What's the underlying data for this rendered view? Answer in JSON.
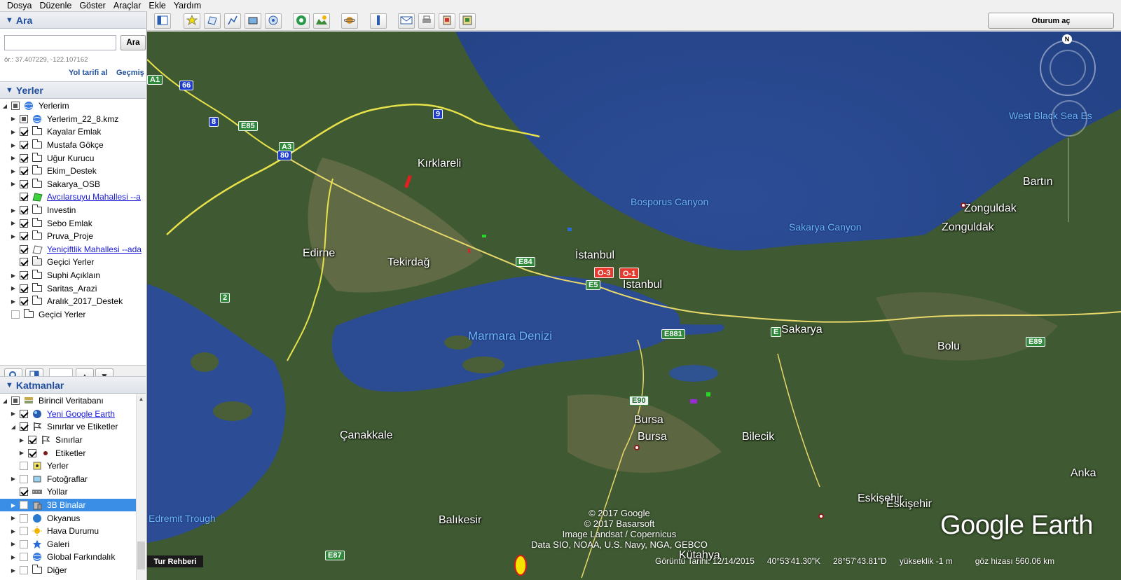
{
  "menu": [
    "Dosya",
    "Düzenle",
    "Göster",
    "Araçlar",
    "Ekle",
    "Yardım"
  ],
  "search": {
    "header": "Ara",
    "input_value": "",
    "button": "Ara",
    "hint": "ör.: 37.407229, -122.107162",
    "directions": "Yol tarifi al",
    "history": "Geçmiş"
  },
  "places": {
    "header": "Yerler",
    "items": [
      {
        "label": "Yerlerim",
        "icon": "globe-icon",
        "check": "partial",
        "expand": "down",
        "indent": 0
      },
      {
        "label": "Yerlerim_22_8.kmz",
        "icon": "globe-icon",
        "check": "partial",
        "expand": "right",
        "indent": 1
      },
      {
        "label": "Kayalar Emlak",
        "icon": "folder-icon",
        "check": "on",
        "expand": "right",
        "indent": 1
      },
      {
        "label": "Mustafa Gökçe",
        "icon": "folder-icon",
        "check": "on",
        "expand": "right",
        "indent": 1
      },
      {
        "label": "Uğur Kurucu",
        "icon": "folder-icon",
        "check": "on",
        "expand": "right",
        "indent": 1
      },
      {
        "label": "Ekim_Destek",
        "icon": "folder-icon",
        "check": "on",
        "expand": "right",
        "indent": 1
      },
      {
        "label": "Sakarya_OSB",
        "icon": "folder-icon",
        "check": "on",
        "expand": "right",
        "indent": 1
      },
      {
        "label": "Avcılarsuyu Mahallesi --a",
        "icon": "polygon-green-icon",
        "check": "on",
        "expand": "none",
        "indent": 1,
        "link": true
      },
      {
        "label": "Investin",
        "icon": "folder-icon",
        "check": "on",
        "expand": "right",
        "indent": 1
      },
      {
        "label": "Sebo Emlak",
        "icon": "folder-icon",
        "check": "on",
        "expand": "right",
        "indent": 1
      },
      {
        "label": "Pruva_Proje",
        "icon": "folder-icon",
        "check": "on",
        "expand": "right",
        "indent": 1
      },
      {
        "label": "Yeniçiftlik Mahallesi --ada",
        "icon": "polygon-white-icon",
        "check": "on",
        "expand": "none",
        "indent": 1,
        "link": true
      },
      {
        "label": "Geçici Yerler",
        "icon": "temp-folder-icon",
        "check": "on",
        "expand": "none",
        "indent": 1
      },
      {
        "label": "Suphi Açıklaın",
        "icon": "folder-icon",
        "check": "on",
        "expand": "right",
        "indent": 1
      },
      {
        "label": "Saritas_Arazi",
        "icon": "folder-icon",
        "check": "on",
        "expand": "right",
        "indent": 1
      },
      {
        "label": "Aralık_2017_Destek",
        "icon": "folder-icon",
        "check": "on",
        "expand": "right",
        "indent": 1
      },
      {
        "label": "Geçici Yerler",
        "icon": "folder-icon",
        "check": "empty",
        "expand": "none",
        "indent": 0
      }
    ]
  },
  "layers": {
    "header": "Katmanlar",
    "items": [
      {
        "label": "Birincil Veritabanı",
        "icon": "layers-db-icon",
        "check": "partial",
        "expand": "down",
        "indent": 0
      },
      {
        "label": "Yeni Google Earth",
        "icon": "globe-blue-icon",
        "check": "on",
        "expand": "right",
        "indent": 1,
        "link": true
      },
      {
        "label": "Sınırlar ve Etiketler",
        "icon": "flag-icon",
        "check": "on",
        "expand": "down",
        "indent": 1
      },
      {
        "label": "Sınırlar",
        "icon": "flag-icon",
        "check": "on",
        "expand": "right",
        "indent": 2
      },
      {
        "label": "Etiketler",
        "icon": "dot-icon",
        "check": "on",
        "expand": "right",
        "indent": 2
      },
      {
        "label": "Yerler",
        "icon": "places-square-icon",
        "check": "empty",
        "expand": "none",
        "indent": 1
      },
      {
        "label": "Fotoğraflar",
        "icon": "photo-icon",
        "check": "empty",
        "expand": "right",
        "indent": 1
      },
      {
        "label": "Yollar",
        "icon": "road-icon",
        "check": "on",
        "expand": "none",
        "indent": 1
      },
      {
        "label": "3B Binalar",
        "icon": "building-icon",
        "check": "empty",
        "expand": "right",
        "indent": 1,
        "selected": true
      },
      {
        "label": "Okyanus",
        "icon": "ocean-icon",
        "check": "empty",
        "expand": "right",
        "indent": 1
      },
      {
        "label": "Hava Durumu",
        "icon": "sun-icon",
        "check": "empty",
        "expand": "right",
        "indent": 1
      },
      {
        "label": "Galeri",
        "icon": "star-icon",
        "check": "empty",
        "expand": "right",
        "indent": 1
      },
      {
        "label": "Global Farkındalık",
        "icon": "globe-icon",
        "check": "empty",
        "expand": "right",
        "indent": 1
      },
      {
        "label": "Diğer",
        "icon": "folder-icon",
        "check": "empty",
        "expand": "right",
        "indent": 1
      }
    ]
  },
  "toolbar": {
    "signin": "Oturum aç",
    "buttons": [
      "sidebar-toggle-icon",
      "placemark-icon",
      "polygon-icon",
      "path-icon",
      "image-overlay-icon",
      "record-tour-icon",
      "historical-imagery-icon",
      "sunlight-icon",
      "planet-icon",
      "ruler-icon",
      "email-icon",
      "print-icon",
      "save-image-icon",
      "view-in-maps-icon"
    ]
  },
  "map": {
    "cities": [
      {
        "name": "Kırklareli"
      },
      {
        "name": "Edirne"
      },
      {
        "name": "Tekirdağ"
      },
      {
        "name": "İstanbul"
      },
      {
        "name": "İstanbul"
      },
      {
        "name": "Sakarya"
      },
      {
        "name": "Bolu"
      },
      {
        "name": "Bartın"
      },
      {
        "name": "Zonguldak"
      },
      {
        "name": "Zonguldak"
      },
      {
        "name": "Çanakkale"
      },
      {
        "name": "Bursa"
      },
      {
        "name": "Bursa"
      },
      {
        "name": "Bilecik"
      },
      {
        "name": "Eskişehir"
      },
      {
        "name": "Eskişehir"
      },
      {
        "name": "Balıkesir"
      },
      {
        "name": "Kütahya"
      },
      {
        "name": "Anka"
      }
    ],
    "water": [
      "Marmara Denizi",
      "Bosporus Canyon",
      "Sakarya Canyon",
      "West Black Sea Es",
      "Edremit Trough"
    ],
    "shields": [
      "A1",
      "66",
      "8",
      "E85",
      "A3",
      "80",
      "9",
      "E84",
      "E5",
      "2",
      "E881",
      "E",
      "E90",
      "E89",
      "E87",
      "O-3",
      "O-1"
    ],
    "copyright": [
      "© 2017 Google",
      "© 2017 Basarsoft",
      "Image Landsat / Copernicus",
      "Data SIO, NOAA, U.S. Navy, NGA, GEBCO"
    ],
    "logo": "Google Earth",
    "compass_north": "N"
  },
  "status": {
    "tour": "Tur Rehberi",
    "date": "Görüntü Tarihi: 12/14/2015",
    "lat": "40°53'41.30\"K",
    "lon": "28°57'43.81\"D",
    "elev": "yükseklik   -1 m",
    "eye": "göz hizası 560.06 km"
  }
}
